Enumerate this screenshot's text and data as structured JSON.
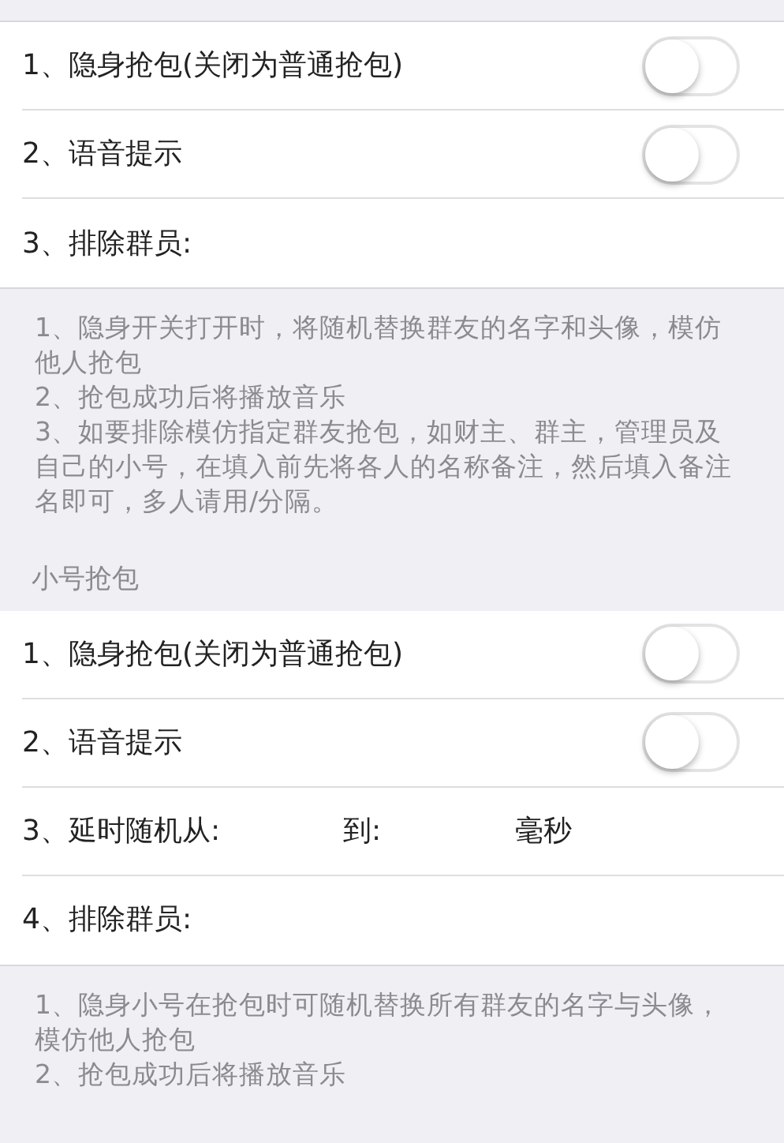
{
  "sections": [
    {
      "rows": [
        {
          "kind": "switch",
          "label": "1、隐身抢包(关闭为普通抢包)",
          "on": false
        },
        {
          "kind": "switch",
          "label": "2、语音提示",
          "on": false
        },
        {
          "kind": "text",
          "label": "3、排除群员:"
        }
      ],
      "notes": [
        "1、隐身开关打开时，将随机替换群友的名字和头像，模仿他人抢包",
        "2、抢包成功后将播放音乐",
        "3、如要排除模仿指定群友抢包，如财主、群主，管理员及自己的小号，在填入前先将各人的名称备注，然后填入备注名即可，多人请用/分隔。"
      ]
    },
    {
      "title": "小号抢包",
      "rows": [
        {
          "kind": "switch",
          "label": "1、隐身抢包(关闭为普通抢包)",
          "on": false
        },
        {
          "kind": "switch",
          "label": "2、语音提示",
          "on": false
        },
        {
          "kind": "range",
          "label": "3、延时随机从:",
          "to": "到:",
          "unit": "毫秒"
        },
        {
          "kind": "text",
          "label": "4、排除群员:"
        }
      ],
      "notes": [
        "1、隐身小号在抢包时可随机替换所有群友的名字与头像，模仿他人抢包",
        "2、抢包成功后将播放音乐"
      ]
    }
  ]
}
